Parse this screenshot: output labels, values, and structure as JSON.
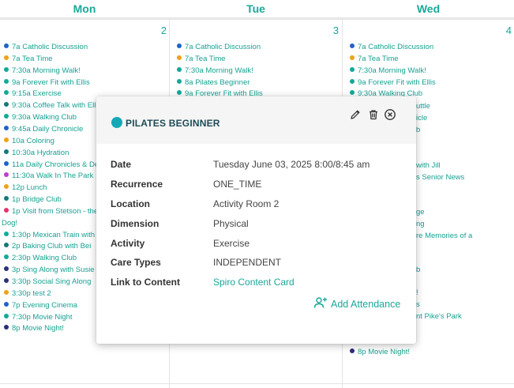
{
  "calendar": {
    "days": [
      {
        "name": "Mon",
        "number": "2"
      },
      {
        "name": "Tue",
        "number": "3"
      },
      {
        "name": "Wed",
        "number": "4"
      }
    ],
    "mon_events": [
      {
        "text": "7a Catholic Discussion",
        "color": "#1e63c9"
      },
      {
        "text": "7a Tea Time",
        "color": "#f0a11a"
      },
      {
        "text": "7:30a Morning Walk!",
        "color": "#14a89a"
      },
      {
        "text": "9a Forever Fit with Ellis",
        "color": "#14a89a"
      },
      {
        "text": "9:15a Exercise",
        "color": "#14a89a"
      },
      {
        "text": "9:30a Coffee Talk with Ellis",
        "color": "#15787a"
      },
      {
        "text": "9:30a Walking Club",
        "color": "#14a89a"
      },
      {
        "text": "9:45a Daily Chronicle",
        "color": "#1e63c9"
      },
      {
        "text": "10a Coloring",
        "color": "#f0a11a"
      },
      {
        "text": "10:30a Hydration",
        "color": "#15787a"
      },
      {
        "text": "11a Daily Chronicles & De",
        "color": "#1e63c9"
      },
      {
        "text": "11:30a Walk In The Park",
        "color": "#c03cd4"
      },
      {
        "text": "12p Lunch",
        "color": "#f0a11a"
      },
      {
        "text": "1p Bridge Club",
        "color": "#15787a"
      },
      {
        "text": "1p Visit from Stetson - the",
        "color": "#e0366a"
      },
      {
        "text": "Dog!",
        "color": ""
      },
      {
        "text": "1:30p Mexican Train with",
        "color": "#14a89a"
      },
      {
        "text": "2p Baking Club with Bei",
        "color": "#15787a"
      },
      {
        "text": "2:30p Walking Club",
        "color": "#14a89a"
      },
      {
        "text": "3p Sing Along with Susie",
        "color": "#2a2f7a"
      },
      {
        "text": "3:30p Social Sing Along",
        "color": "#2a2f7a"
      },
      {
        "text": "3:30p test 2",
        "color": "#f0a11a"
      },
      {
        "text": "7p Evening Cinema",
        "color": "#1e63c9"
      },
      {
        "text": "7:30p Movie Night",
        "color": "#14a89a"
      },
      {
        "text": "8p Movie Night!",
        "color": "#2a2f7a"
      }
    ],
    "tue_events": [
      {
        "text": "7a Catholic Discussion",
        "color": "#1e63c9"
      },
      {
        "text": "7a Tea Time",
        "color": "#f0a11a"
      },
      {
        "text": "7:30a Morning Walk!",
        "color": "#14a89a"
      },
      {
        "text": "8a Pilates Beginner",
        "color": "#14a89a"
      },
      {
        "text": "9a Forever Fit with Ellis",
        "color": "#14a89a"
      }
    ],
    "wed_events": [
      {
        "text": "7a Catholic Discussion",
        "color": "#1e63c9"
      },
      {
        "text": "7a Tea Time",
        "color": "#f0a11a"
      },
      {
        "text": "7:30a Morning Walk!",
        "color": "#14a89a"
      },
      {
        "text": "9a Forever Fit with Ellis",
        "color": "#14a89a"
      },
      {
        "text": "9:30a Walking Club",
        "color": "#14a89a"
      }
    ],
    "wed_fragments": [
      "uttle",
      "icle",
      "b",
      "with Jill",
      "s Senior News",
      "ge",
      "ng",
      "re Memories of a",
      "b",
      "!",
      "s",
      "nt Pike's Park"
    ],
    "wed_last_event": {
      "text": "8p Movie Night!",
      "color": "#2a2f7a"
    }
  },
  "popup": {
    "title": "PILATES BEGINNER",
    "title_dot_color": "#17a8b8",
    "icons": {
      "edit": "pencil-icon",
      "delete": "trash-icon",
      "close": "close-circle-icon"
    },
    "fields": [
      {
        "label": "Date",
        "value": "Tuesday June 03, 2025 8:00/8:45 am"
      },
      {
        "label": "Recurrence",
        "value": "ONE_TIME"
      },
      {
        "label": "Location",
        "value": "Activity Room 2"
      },
      {
        "label": "Dimension",
        "value": "Physical"
      },
      {
        "label": "Activity",
        "value": "Exercise"
      },
      {
        "label": "Care Types",
        "value": "INDEPENDENT"
      },
      {
        "label": "Link to Content",
        "value": "Spiro Content Card"
      }
    ],
    "add_attendance": "Add Attendance"
  }
}
